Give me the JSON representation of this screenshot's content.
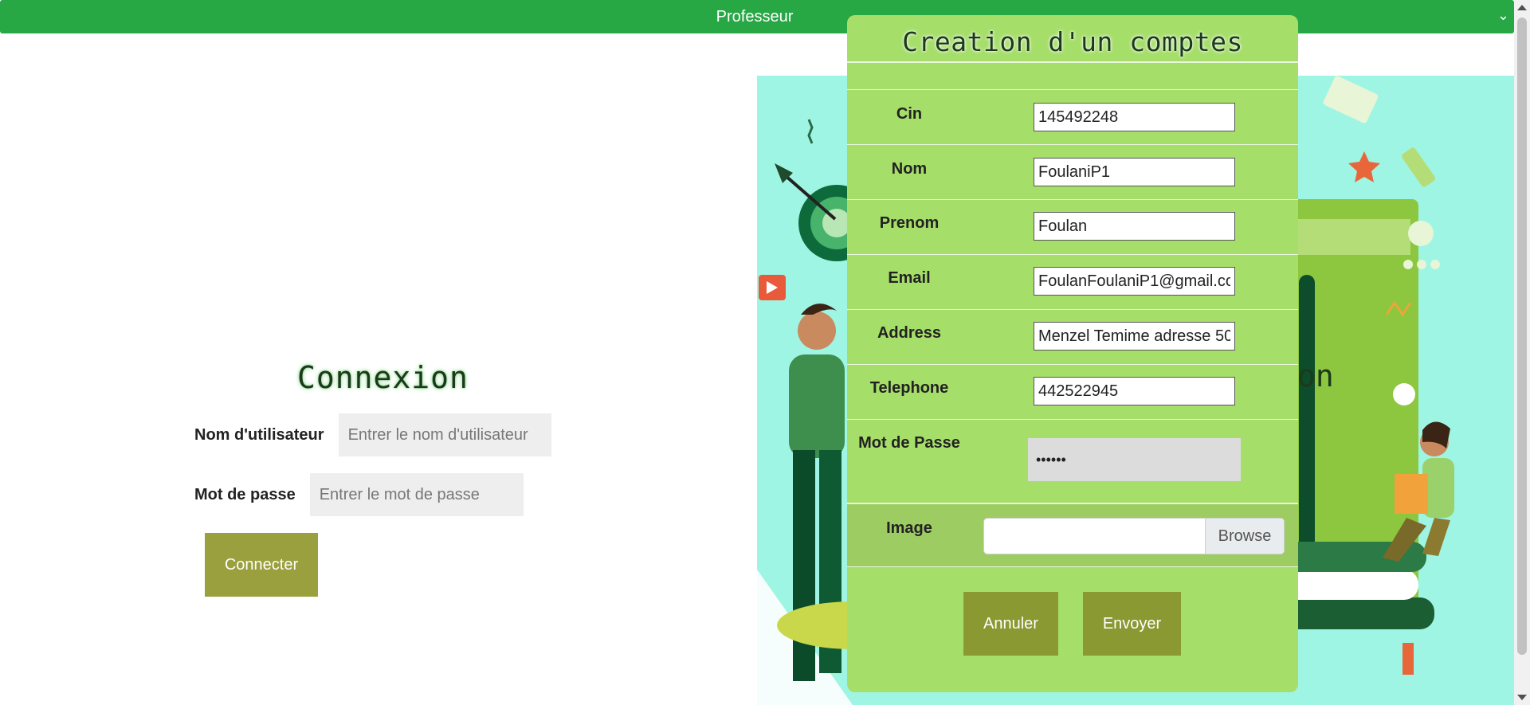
{
  "topbar": {
    "title": "Professeur"
  },
  "login": {
    "title": "Connexion",
    "username_label": "Nom d'utilisateur",
    "username_placeholder": "Entrer le nom d'utilisateur",
    "password_label": "Mot de passe",
    "password_placeholder": "Entrer le mot de passe",
    "submit_label": "Connecter"
  },
  "background_partial_text": "on",
  "modal": {
    "title": "Creation d'un comptes",
    "fields": [
      {
        "label": "Cin",
        "value": "145492248"
      },
      {
        "label": "Nom",
        "value": "FoulaniP1"
      },
      {
        "label": "Prenom",
        "value": "Foulan"
      },
      {
        "label": "Email",
        "value": "FoulanFoulaniP1@gmail.cc"
      },
      {
        "label": "Address",
        "value": "Menzel Temime adresse 50"
      },
      {
        "label": "Telephone",
        "value": "442522945"
      }
    ],
    "password": {
      "label": "Mot de Passe",
      "value": "••••••"
    },
    "image": {
      "label": "Image",
      "browse_label": "Browse"
    },
    "cancel_label": "Annuler",
    "submit_label": "Envoyer"
  },
  "colors": {
    "topbar": "#28a745",
    "modal_bg": "#a6de6a",
    "button_olive": "#9aa03d",
    "modal_button": "#8a9932",
    "illustration_bg": "#9ff5e3"
  },
  "icons": [
    "chevron-down-icon"
  ]
}
